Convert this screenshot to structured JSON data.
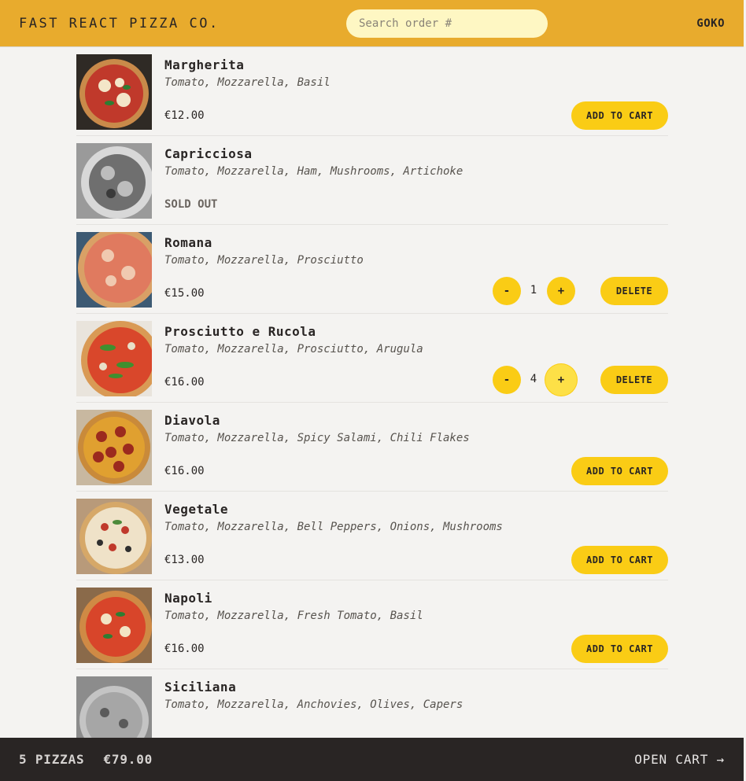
{
  "header": {
    "logo": "FAST REACT PIZZA CO.",
    "search_placeholder": "Search order #",
    "username": "GOKO"
  },
  "menu": [
    {
      "name": "Margherita",
      "ingredients": "Tomato, Mozzarella, Basil",
      "price": "€12.00",
      "action": "ADD TO CART"
    },
    {
      "name": "Capricciosa",
      "ingredients": "Tomato, Mozzarella, Ham, Mushrooms, Artichoke",
      "status": "SOLD OUT"
    },
    {
      "name": "Romana",
      "ingredients": "Tomato, Mozzarella, Prosciutto",
      "price": "€15.00",
      "quantity": "1",
      "minus": "-",
      "plus": "+",
      "delete": "DELETE"
    },
    {
      "name": "Prosciutto e Rucola",
      "ingredients": "Tomato, Mozzarella, Prosciutto, Arugula",
      "price": "€16.00",
      "quantity": "4",
      "minus": "-",
      "plus": "+",
      "delete": "DELETE"
    },
    {
      "name": "Diavola",
      "ingredients": "Tomato, Mozzarella, Spicy Salami, Chili Flakes",
      "price": "€16.00",
      "action": "ADD TO CART"
    },
    {
      "name": "Vegetale",
      "ingredients": "Tomato, Mozzarella, Bell Peppers, Onions, Mushrooms",
      "price": "€13.00",
      "action": "ADD TO CART"
    },
    {
      "name": "Napoli",
      "ingredients": "Tomato, Mozzarella, Fresh Tomato, Basil",
      "price": "€16.00",
      "action": "ADD TO CART"
    },
    {
      "name": "Siciliana",
      "ingredients": "Tomato, Mozzarella, Anchovies, Olives, Capers"
    }
  ],
  "cart_overview": {
    "pizza_count": "5 PIZZAS",
    "total": "€79.00",
    "open_cart": "OPEN CART →"
  },
  "colors": {
    "header_bg": "#e8ab2d",
    "button_yellow": "#facc15",
    "footer_bg": "#292524",
    "page_bg": "#f4f3f1"
  }
}
